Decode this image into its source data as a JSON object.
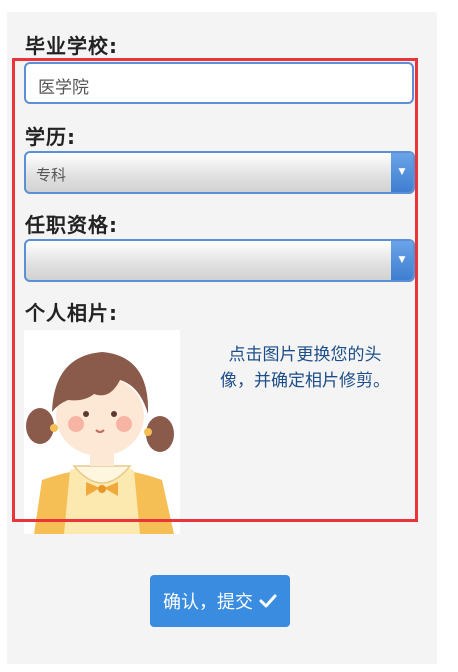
{
  "form": {
    "school_label": "毕业学校:",
    "school_value": "医学院",
    "education_label": "学历:",
    "education_value": "专科",
    "qualification_label": "任职资格:",
    "qualification_value": "",
    "photo_label": "个人相片:",
    "photo_hint": "点击图片更换您的头像，并确定相片修剪。",
    "submit_label": "确认，提交"
  },
  "icons": {
    "select_arrow": "chevron-down-icon",
    "submit_icon": "check-icon"
  },
  "colors": {
    "accent": "#3a8ce0",
    "input_border": "#5b8fd6",
    "highlight_frame": "#e8343a",
    "hint_text": "#1d4e89"
  }
}
